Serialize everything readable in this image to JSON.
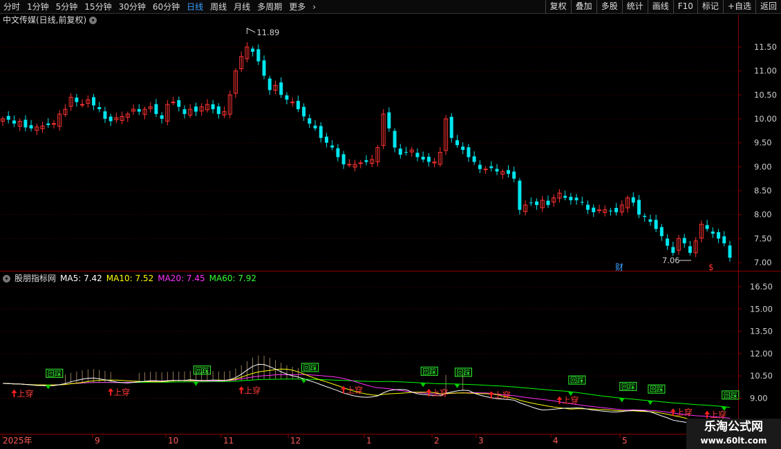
{
  "toolbar": {
    "periods": [
      "分时",
      "1分钟",
      "5分钟",
      "15分钟",
      "30分钟",
      "60分钟",
      "日线",
      "周线",
      "月线",
      "多周期",
      "更多"
    ],
    "active_period": "日线",
    "more_arrow": "›",
    "right_buttons": [
      "复权",
      "叠加",
      "多股",
      "统计",
      "画线",
      "F10",
      "标记",
      "+自选",
      "返回"
    ]
  },
  "chart": {
    "title": "中文传媒(日线,前复权)",
    "high_marker": "11.89",
    "low_marker": "7.06",
    "fin_badge": "财",
    "dollar_badge": "$",
    "price_ticks": [
      "11.50",
      "11.00",
      "10.50",
      "10.00",
      "9.50",
      "9.00",
      "8.50",
      "8.00",
      "7.50",
      "7.00"
    ]
  },
  "indicator": {
    "name": "股朋指标网",
    "ma5": "MA5: 7.42",
    "ma10": "MA10: 7.52",
    "ma20": "MA20: 7.45",
    "ma60": "MA60: 7.92",
    "ticks": [
      "16.50",
      "15.00",
      "13.50",
      "12.00",
      "10.50",
      "9.00"
    ],
    "signal_up": "上穿",
    "signal_pullback": "回踩"
  },
  "dates": {
    "year": "2025年",
    "months": [
      "9",
      "10",
      "11",
      "12",
      "1",
      "2",
      "3",
      "4",
      "5"
    ]
  },
  "colors": {
    "up": "#ff3232",
    "down": "#00e5ee",
    "ma5": "#ffffff",
    "ma10": "#ffff00",
    "ma20": "#ff33ff",
    "ma60": "#00ff00",
    "grid": "#8b0000"
  },
  "chart_data": {
    "type": "candlestick",
    "series": [
      {
        "name": "close",
        "values": [
          10.0,
          9.98,
          9.9,
          9.95,
          9.82,
          9.8,
          9.83,
          9.85,
          9.87,
          9.9,
          10.1,
          10.2,
          10.45,
          10.35,
          10.3,
          10.4,
          10.28,
          10.2,
          10.0,
          9.95,
          10.02,
          10.05,
          10.1,
          10.2,
          10.15,
          10.2,
          10.25,
          10.1,
          10.0,
          10.3,
          10.35,
          10.25,
          10.1,
          10.2,
          10.15,
          10.25,
          10.3,
          10.2,
          10.1,
          10.15,
          10.5,
          11.0,
          11.3,
          11.5,
          11.4,
          11.2,
          10.9,
          10.6,
          10.7,
          10.5,
          10.4,
          10.35,
          10.2,
          10.05,
          9.9,
          9.8,
          9.6,
          9.5,
          9.4,
          9.2,
          9.05,
          9.05,
          9.05,
          9.08,
          9.1,
          9.15,
          9.4,
          10.1,
          9.8,
          9.4,
          9.25,
          9.3,
          9.35,
          9.2,
          9.15,
          9.1,
          9.1,
          9.3,
          10.0,
          9.6,
          9.45,
          9.35,
          9.2,
          9.1,
          8.95,
          8.95,
          8.97,
          8.9,
          8.9,
          8.85,
          8.75,
          8.1,
          8.2,
          8.25,
          8.2,
          8.3,
          8.2,
          8.35,
          8.45,
          8.35,
          8.3,
          8.3,
          8.25,
          8.1,
          8.05,
          8.1,
          8.1,
          8.08,
          8.05,
          8.2,
          8.35,
          8.25,
          8.0,
          7.95,
          7.85,
          7.7,
          7.55,
          7.35,
          7.2,
          7.5,
          7.4,
          7.2,
          7.45,
          7.8,
          7.7,
          7.6,
          7.5,
          7.4,
          7.1
        ]
      }
    ],
    "ylim": [
      6.9,
      12.05
    ],
    "x": [
      "2025年",
      "9",
      "10",
      "11",
      "12",
      "1",
      "2",
      "3",
      "4",
      "5"
    ]
  }
}
